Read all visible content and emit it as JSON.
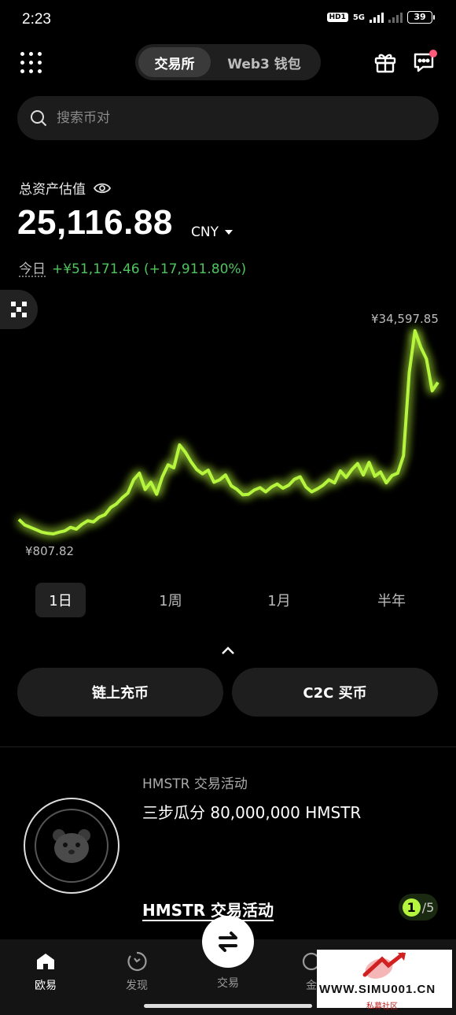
{
  "status_bar": {
    "time": "2:23",
    "network_badge": "HD1",
    "network_type": "5G",
    "battery": "39"
  },
  "header": {
    "tabs": [
      {
        "label": "交易所",
        "active": true
      },
      {
        "label": "Web3 钱包",
        "active": false
      }
    ],
    "icons": [
      "apps-grid-icon",
      "gift-icon",
      "chat-icon"
    ]
  },
  "search": {
    "placeholder": "搜索币对"
  },
  "assets": {
    "label": "总资产估值",
    "value": "25,116.88",
    "currency": "CNY",
    "today_label": "今日",
    "today_change": "+¥51,171.46 (+17,911.80%)"
  },
  "chart": {
    "max_label": "¥34,597.85",
    "min_label": "¥807.82",
    "line_color": "#b6f53e"
  },
  "chart_data": {
    "type": "line",
    "series": [
      {
        "values": [
          3200,
          2300,
          1900,
          1500,
          1100,
          900,
          808,
          1100,
          1300,
          1900,
          1600,
          2400,
          3000,
          2800,
          3600,
          4000,
          5200,
          5800,
          6800,
          7600,
          9800,
          10900,
          8200,
          9400,
          7400,
          10300,
          12300,
          11800,
          15600,
          14400,
          12800,
          11500,
          10800,
          11400,
          9400,
          9800,
          10600,
          8800,
          8200,
          7300,
          7400,
          8100,
          8500,
          7800,
          8600,
          9100,
          8400,
          8900,
          9900,
          10300,
          8600,
          7800,
          8300,
          8900,
          9800,
          9300,
          11300,
          10200,
          11500,
          12500,
          10600,
          12700,
          10400,
          11100,
          9300,
          10500,
          10900,
          13800,
          27600,
          34598,
          31900,
          29900,
          24600,
          26000
        ]
      }
    ],
    "ylim": [
      808,
      34598
    ]
  },
  "period_tabs": [
    {
      "label": "1日",
      "active": true
    },
    {
      "label": "1周",
      "active": false
    },
    {
      "label": "1月",
      "active": false
    },
    {
      "label": "半年",
      "active": false
    }
  ],
  "actions": {
    "deposit": "链上充币",
    "c2c_buy": "C2C 买币"
  },
  "promo": {
    "subtitle": "HMSTR 交易活动",
    "title": "三步瓜分 80,000,000 HMSTR",
    "link": "HMSTR 交易活动",
    "page_current": "1",
    "page_total": "/5"
  },
  "bottom_nav": [
    {
      "label": "欧易",
      "icon": "home-icon",
      "active": true
    },
    {
      "label": "发现",
      "icon": "discover-icon",
      "active": false
    },
    {
      "label": "交易",
      "icon": "swap-icon",
      "active": false
    },
    {
      "label": "金",
      "icon": "finance-icon",
      "active": false
    }
  ],
  "watermark": {
    "text": "WWW.SIMU001.CN",
    "sub": "私募社区"
  }
}
